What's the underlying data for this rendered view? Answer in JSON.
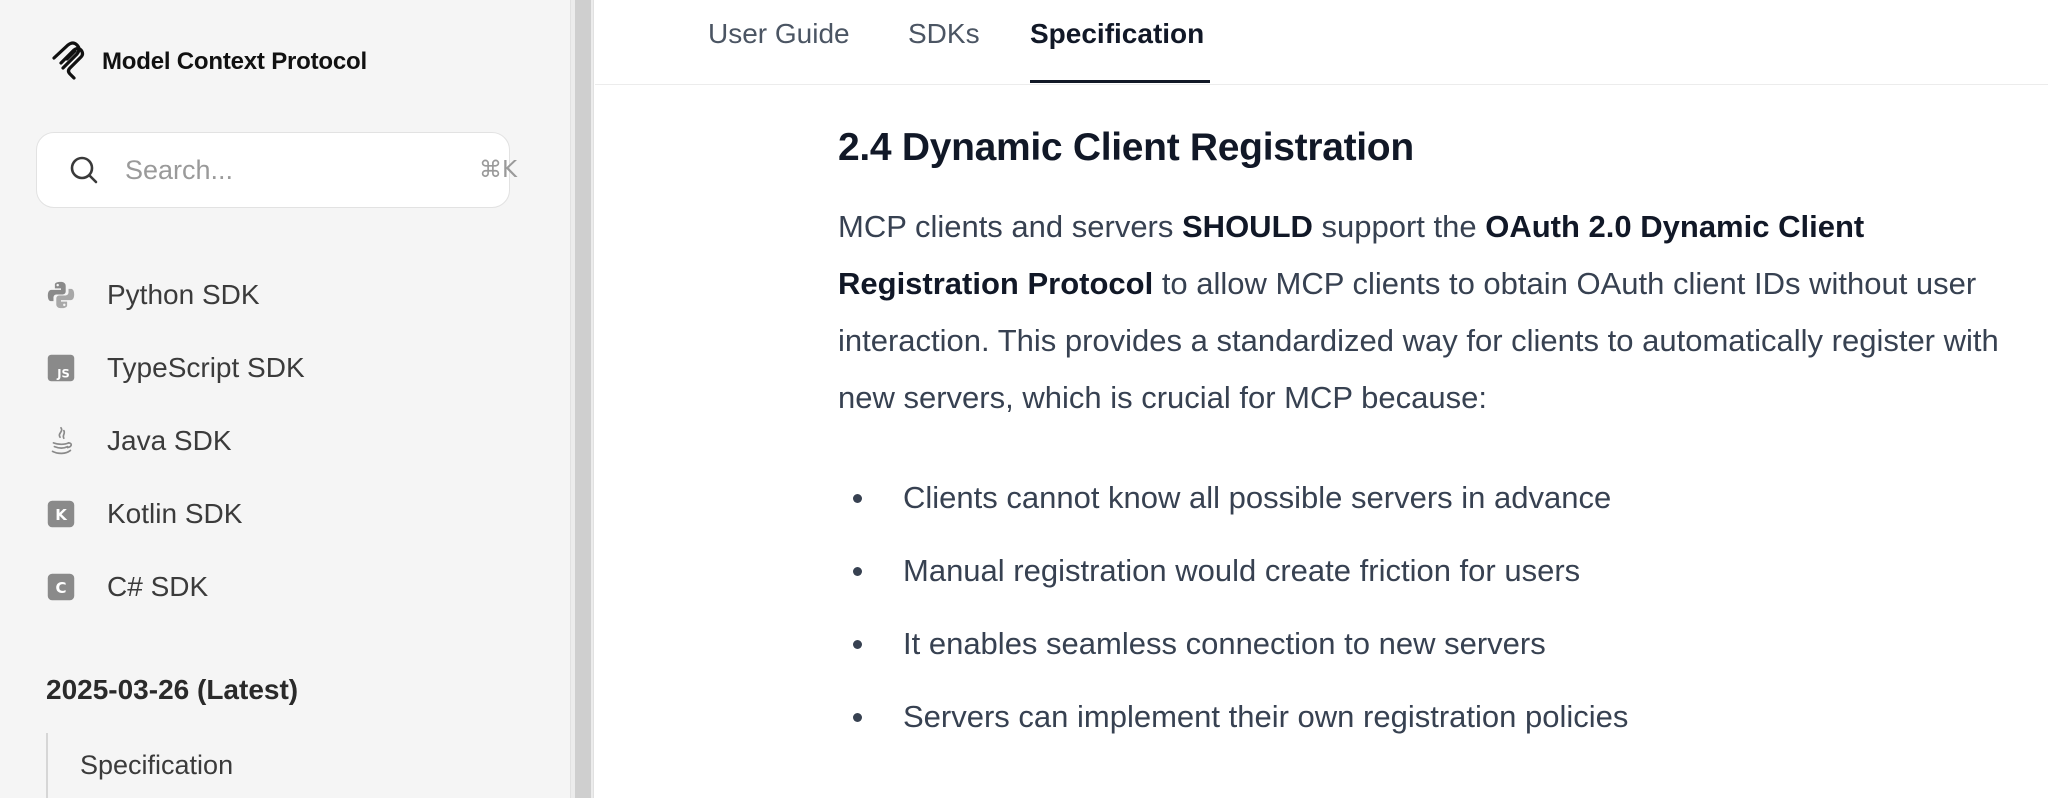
{
  "sidebar": {
    "logo_text": "Model Context Protocol",
    "search": {
      "placeholder": "Search...",
      "shortcut": "⌘K"
    },
    "items": [
      {
        "label": "Python SDK",
        "icon": "python-icon"
      },
      {
        "label": "TypeScript SDK",
        "icon": "typescript-js-icon"
      },
      {
        "label": "Java SDK",
        "icon": "java-icon"
      },
      {
        "label": "Kotlin SDK",
        "icon": "kotlin-icon"
      },
      {
        "label": "C# SDK",
        "icon": "csharp-icon"
      }
    ],
    "section_title": "2025-03-26 (Latest)",
    "sub_items": [
      "Specification"
    ]
  },
  "topnav": {
    "tabs": [
      {
        "label": "User Guide",
        "active": false
      },
      {
        "label": "SDKs",
        "active": false
      },
      {
        "label": "Specification",
        "active": true
      }
    ]
  },
  "content": {
    "heading": "2.4 Dynamic Client Registration",
    "para": {
      "t1": "MCP clients and servers ",
      "b1": "SHOULD",
      "t2": " support the ",
      "b2": "OAuth 2.0 Dynamic Client Registration Protocol",
      "t3": " to allow MCP clients to obtain OAuth client IDs without user interaction. This provides a standardized way for clients to automatically register with new servers, which is crucial for MCP because:"
    },
    "bullets": [
      "Clients cannot know all possible servers in advance",
      "Manual registration would create friction for users",
      "It enables seamless connection to new servers",
      "Servers can implement their own registration policies"
    ]
  },
  "colors": {
    "sidebar_bg": "#f5f5f5",
    "text_primary": "#111827",
    "text_body": "#374151",
    "icon_gray": "#8a8a8a"
  }
}
